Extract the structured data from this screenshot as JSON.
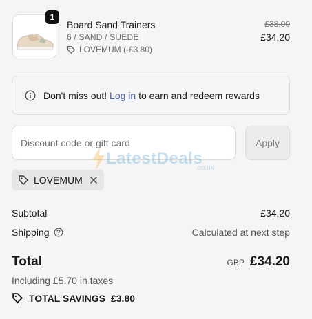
{
  "line_item": {
    "quantity": "1",
    "title": "Board Sand Trainers",
    "variant": "6 / SAND / SUEDE",
    "discount": "LOVEMUM (-£3.80)",
    "original_price": "£38.00",
    "price": "£34.20"
  },
  "notice": {
    "lead": "Don't miss out!",
    "link": "Log in",
    "trail": "to earn and redeem rewards"
  },
  "discount_form": {
    "placeholder": "Discount code or gift card",
    "value": "",
    "apply_label": "Apply"
  },
  "applied_code": "LOVEMUM",
  "watermark": {
    "main": "LatestDeals",
    "sub": ".co.uk"
  },
  "summary": {
    "subtotal_label": "Subtotal",
    "subtotal_value": "£34.20",
    "shipping_label": "Shipping",
    "shipping_value": "Calculated at next step",
    "total_label": "Total",
    "currency": "GBP",
    "total_value": "£34.20",
    "taxes": "Including £5.70 in taxes",
    "savings_label": "TOTAL SAVINGS",
    "savings_value": "£3.80"
  },
  "icons": [
    "info-icon",
    "tag-icon",
    "close-icon",
    "question-icon",
    "shoe-image",
    "bolt-icon"
  ]
}
